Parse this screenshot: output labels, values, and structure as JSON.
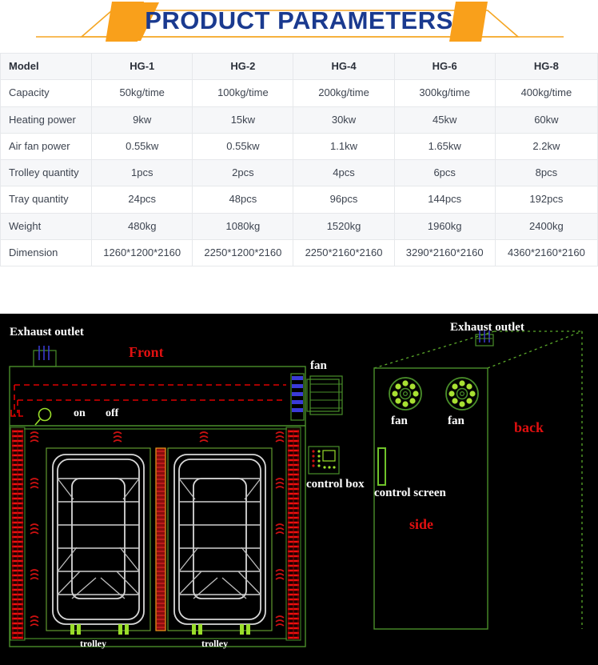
{
  "banner": {
    "title": "PRODUCT PARAMETERS",
    "title_color": "#1a3a8f",
    "accent_color": "#f5a623"
  },
  "table": {
    "columns": [
      "Model",
      "HG-1",
      "HG-2",
      "HG-4",
      "HG-6",
      "HG-8"
    ],
    "rows": [
      {
        "label": "Capacity",
        "values": [
          "50kg/time",
          "100kg/time",
          "200kg/time",
          "300kg/time",
          "400kg/time"
        ]
      },
      {
        "label": "Heating power",
        "values": [
          "9kw",
          "15kw",
          "30kw",
          "45kw",
          "60kw"
        ]
      },
      {
        "label": "Air fan power",
        "values": [
          "0.55kw",
          "0.55kw",
          "1.1kw",
          "1.65kw",
          "2.2kw"
        ]
      },
      {
        "label": "Trolley quantity",
        "values": [
          "1pcs",
          "2pcs",
          "4pcs",
          "6pcs",
          "8pcs"
        ]
      },
      {
        "label": "Tray quantity",
        "values": [
          "24pcs",
          "48pcs",
          "96pcs",
          "144pcs",
          "192pcs"
        ]
      },
      {
        "label": "Weight",
        "values": [
          "480kg",
          "1080kg",
          "1520kg",
          "1960kg",
          "2400kg"
        ]
      },
      {
        "label": "Dimension",
        "values": [
          "1260*1200*2160",
          "2250*1200*2160",
          "2250*2160*2160",
          "3290*2160*2160",
          "4360*2160*2160"
        ]
      }
    ]
  },
  "drawing": {
    "background": "#000000",
    "outline_color": "#4a8f2a",
    "heater_color": "#e01010",
    "accent_green": "#9ade2a",
    "labels": {
      "exhaust_outlet_left": "Exhaust outlet",
      "exhaust_outlet_right": "Exhaust outlet",
      "front": "Front",
      "back": "back",
      "side": "side",
      "on": "on",
      "off": "off",
      "fan_top": "fan",
      "fan_side_left": "fan",
      "fan_side_right": "fan",
      "control_box": "control box",
      "control_screen": "control screen",
      "trolley_left": "trolley",
      "trolley_right": "trolley"
    }
  }
}
